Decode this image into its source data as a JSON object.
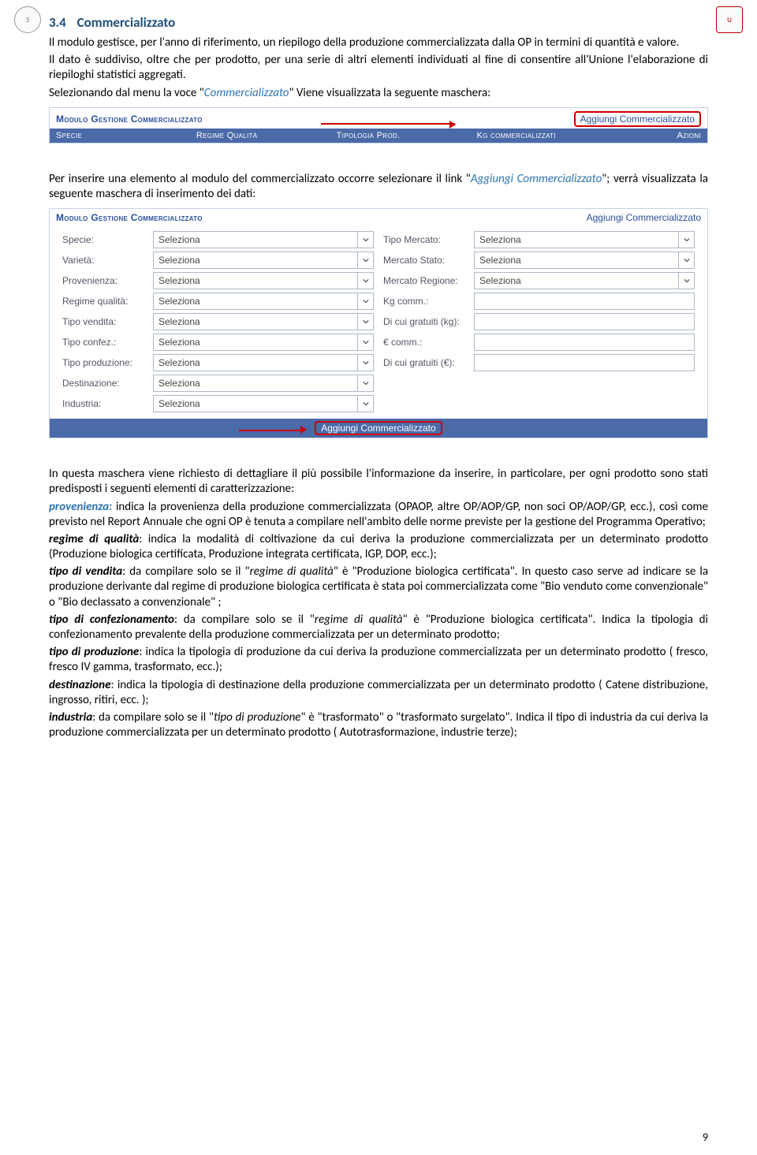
{
  "section": {
    "number": "3.4",
    "title": "Commercializzato"
  },
  "p1": "Il modulo gestisce, per l'anno di riferimento, un riepilogo della produzione commercializzata dalla OP in termini di quantità e valore.",
  "p2": "Il dato è suddiviso, oltre che per prodotto, per una serie di altri elementi individuati al fine di consentire all'Unione l'elaborazione di riepiloghi statistici aggregati.",
  "p3a": "Selezionando dal menu la voce \"",
  "p3b": "Commercializzato",
  "p3c": "\" Viene visualizzata la seguente maschera:",
  "shot1": {
    "title": "Modulo Gestione Commercializzato",
    "link": "Aggiungi Commercializzato",
    "cols": {
      "c1": "Specie",
      "c2": "Regime Qualità",
      "c3": "Tipologia Prod.",
      "c4": "Kg commercializzati",
      "c5": "Azioni"
    }
  },
  "p4a": "Per inserire una elemento al modulo del commercializzato occorre selezionare il link \"",
  "p4b": "Aggiungi Commercializzato",
  "p4c": "\"; verrà visualizzata la seguente maschera di inserimento dei dati:",
  "shot2": {
    "title": "Modulo Gestione Commercializzato",
    "link": "Aggiungi Commercializzato",
    "sel": "Seleziona",
    "labels": {
      "specie": "Specie:",
      "varieta": "Varietà:",
      "prov": "Provenienza:",
      "regime": "Regime qualità:",
      "tvend": "Tipo vendita:",
      "tconf": "Tipo confez.:",
      "tprod": "Tipo produzione:",
      "dest": "Destinazione:",
      "ind": "Industria:",
      "tmerc": "Tipo Mercato:",
      "mstat": "Mercato Stato:",
      "mreg": "Mercato Regione:",
      "kg": "Kg comm.:",
      "gratkg": "Di cui gratuiti (kg):",
      "eur": "€ comm.:",
      "grateur": "Di cui gratuiti (€):"
    },
    "btn": "Aggiungi Commercializzato"
  },
  "p5": "In questa maschera viene richiesto di dettagliare il più possibile l'informazione da inserire, in particolare, per ogni prodotto sono stati predisposti i seguenti elementi di caratterizzazione:",
  "p6a": "provenienza:",
  "p6b": " indica la provenienza della produzione commercializzata (OPAOP, altre OP/AOP/GP, non soci OP/AOP/GP, ecc.), così come previsto nel Report Annuale che ogni OP è tenuta a compilare nell'ambito delle norme previste per la gestione del Programma Operativo;",
  "p7a": "regime di qualità",
  "p7b": ": indica la modalità di coltivazione da cui deriva la produzione commercializzata per un determinato prodotto (Produzione biologica certificata, Produzione integrata certificata, IGP, DOP, ecc.);",
  "p8a": "tipo di vendita",
  "p8b": ": da compilare solo se il \"",
  "p8c": "regime di qualità",
  "p8d": "\" è \"Produzione biologica certificata\". In questo caso serve ad indicare se la produzione derivante dal regime di produzione biologica certificata è stata poi commercializzata come \"Bio venduto come convenzionale\" o \"Bio declassato a convenzionale\" ;",
  "p9a": "tipo di confezionamento",
  "p9b": ": da compilare solo se il \"",
  "p9c": "regime di qualità",
  "p9d": "\" è \"Produzione biologica certificata\". Indica la tipologia di confezionamento prevalente della produzione commercializzata per un determinato prodotto;",
  "p10a": "tipo di produzione",
  "p10b": ": indica la tipologia di produzione da cui deriva la produzione commercializzata per un determinato prodotto ( fresco, fresco IV gamma, trasformato, ecc.);",
  "p11a": "destinazione",
  "p11b": ": indica la tipologia di destinazione della produzione commercializzata per un determinato prodotto ( Catene distribuzione, ingrosso, ritiri, ecc. );",
  "p12a": "industria",
  "p12b": ": da compilare solo se il \"",
  "p12c": "tipo di produzione",
  "p12d": "\" è \"trasformato\" o \"trasformato surgelato\". Indica il tipo di industria da cui deriva la produzione commercializzata per un determinato prodotto ( Autotrasformazione, industrie terze);",
  "page": "9"
}
